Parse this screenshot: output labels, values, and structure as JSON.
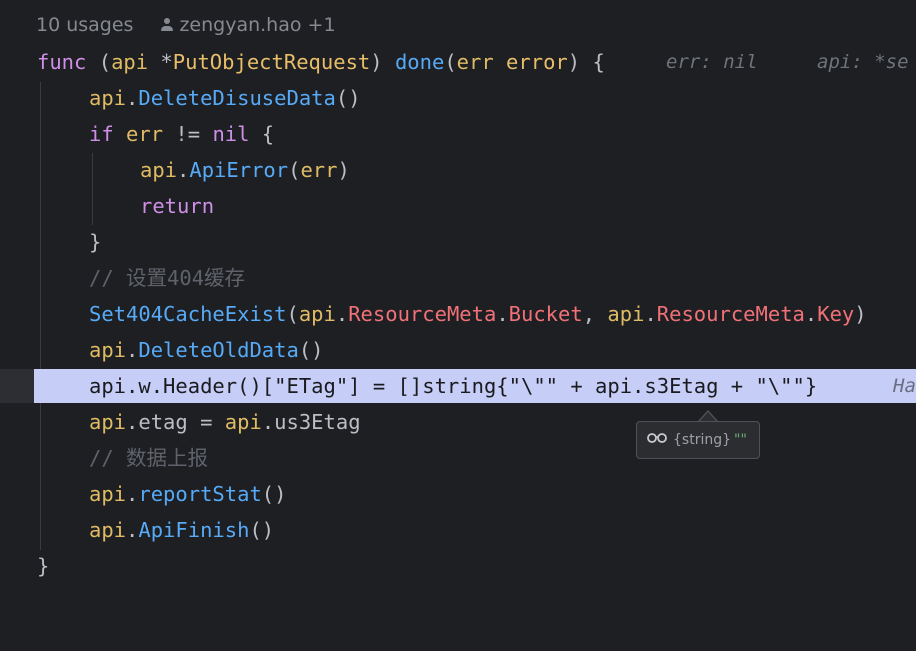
{
  "header": {
    "usages": "10 usages",
    "author": "zengyan.hao +1",
    "author_icon": "person-icon"
  },
  "code": {
    "func_kw": "func",
    "recv_open": " (",
    "recv_name": "api",
    "recv_star": " *",
    "recv_type": "PutObjectRequest",
    "recv_close": ") ",
    "method": "done",
    "params_open": "(",
    "param_name": "err",
    "param_type": " error",
    "params_close": ") {",
    "hint_err": "err: nil",
    "hint_api": "api: *se",
    "l2_api": "api",
    "l2_dot": ".",
    "l2_fn": "DeleteDisuseData",
    "l2_end": "()",
    "l3_if": "if",
    "l3_err": " err",
    "l3_op": " != ",
    "l3_nil": "nil",
    "l3_brace": " {",
    "l4_api": "api",
    "l4_dot": ".",
    "l4_fn": "ApiError",
    "l4_open": "(",
    "l4_err": "err",
    "l4_close": ")",
    "l5_return": "return",
    "l6_brace": "}",
    "l7_comment": "// 设置404缓存",
    "l8_fn": "Set404CacheExist",
    "l8_open": "(",
    "l8_api1": "api",
    "l8_dot1": ".",
    "l8_meta1": "ResourceMeta",
    "l8_dot2": ".",
    "l8_bucket": "Bucket",
    "l8_comma": ", ",
    "l8_api2": "api",
    "l8_dot3": ".",
    "l8_meta2": "ResourceMeta",
    "l8_dot4": ".",
    "l8_key": "Key",
    "l8_close": ")",
    "l9_api": "api",
    "l9_dot": ".",
    "l9_fn": "DeleteOldData",
    "l9_end": "()",
    "l10_text": "api.w.Header()[\"ETag\"] = []string{\"\\\"\" + api.s3Etag + \"\\\"\"}",
    "l10_hint": "Ha",
    "l11_api": "api",
    "l11_mid": ".etag = ",
    "l11_api2": "api",
    "l11_end": ".us3Etag",
    "l12_comment": "// 数据上报",
    "l13_api": "api",
    "l13_dot": ".",
    "l13_fn": "reportStat",
    "l13_end": "()",
    "l14_api": "api",
    "l14_dot": ".",
    "l14_fn": "ApiFinish",
    "l14_end": "()",
    "l15_brace": "}"
  },
  "tooltip": {
    "icon": "glasses-icon",
    "type": "{string}",
    "value": "\"\""
  },
  "colors": {
    "background": "#1e1f22",
    "keyword": "#cf8ee8",
    "function": "#57aaf7",
    "parameter": "#e0bb65",
    "field": "#f07178",
    "comment": "#5f626b",
    "highlight_line": "#c6cdf7"
  }
}
